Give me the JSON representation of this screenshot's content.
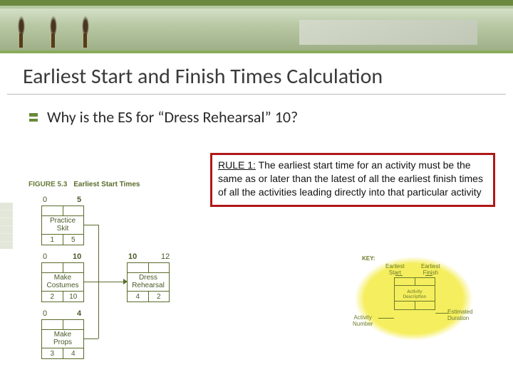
{
  "title": "Earliest Start and Finish Times Calculation",
  "question": "Why is the ES for “Dress Rehearsal” 10?",
  "rule": {
    "label": "RULE 1:",
    "text": " The earliest start time for an activity must be the same as or later than the latest of all the earliest finish times of all the activities leading directly into that particular activity"
  },
  "figure": {
    "number": "FIGURE 5.3",
    "caption": "Earliest Start Times"
  },
  "activities": {
    "a1": {
      "es": "0",
      "ef": "5",
      "name": "Practice\nSkit",
      "num": "1",
      "dur": "5"
    },
    "a2": {
      "es": "0",
      "ef": "10",
      "name": "Make\nCostumes",
      "num": "2",
      "dur": "10"
    },
    "a3": {
      "es": "0",
      "ef": "4",
      "name": "Make\nProps",
      "num": "3",
      "dur": "4"
    },
    "a4": {
      "es": "10",
      "ef": "12",
      "name": "Dress\nRehearsal",
      "num": "4",
      "dur": "2"
    }
  },
  "key": {
    "title": "KEY:",
    "es": "Earliest\nStart",
    "ef": "Earliest\nFinish",
    "desc": "Activity\nDescription",
    "actnum": "Activity\nNumber",
    "estdur": "Estimated\nDuration"
  }
}
